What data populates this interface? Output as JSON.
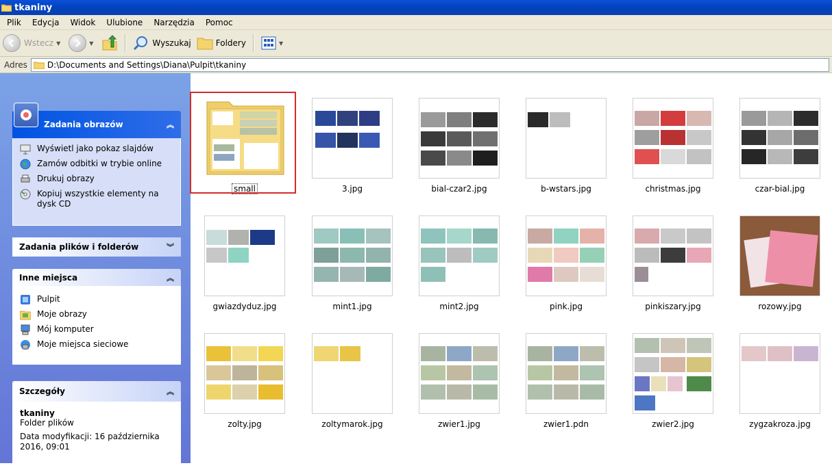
{
  "window": {
    "title": "tkaniny"
  },
  "menu": [
    "Plik",
    "Edycja",
    "Widok",
    "Ulubione",
    "Narzędzia",
    "Pomoc"
  ],
  "toolbar": {
    "back": "Wstecz",
    "search": "Wyszukaj",
    "folders": "Foldery"
  },
  "address": {
    "label": "Adres",
    "path": "D:\\Documents and Settings\\Diana\\Pulpit\\tkaniny"
  },
  "sidebar": {
    "image_tasks": {
      "title": "Zadania obrazów",
      "items": [
        "Wyświetl jako pokaz slajdów",
        "Zamów odbitki w trybie online",
        "Drukuj obrazy",
        "Kopiuj wszystkie elementy na dysk CD"
      ]
    },
    "file_tasks": {
      "title": "Zadania plików i folderów"
    },
    "other_places": {
      "title": "Inne miejsca",
      "items": [
        "Pulpit",
        "Moje obrazy",
        "Mój komputer",
        "Moje miejsca sieciowe"
      ]
    },
    "details": {
      "title": "Szczegóły",
      "name": "tkaniny",
      "type": "Folder plików",
      "modified": "Data modyfikacji: 16 października 2016, 09:01"
    }
  },
  "files": [
    "small",
    "3.jpg",
    "bial-czar2.jpg",
    "b-wstars.jpg",
    "christmas.jpg",
    "czar-bial.jpg",
    "gwiazdyduz.jpg",
    "mint1.jpg",
    "mint2.jpg",
    "pink.jpg",
    "pinkiszary.jpg",
    "rozowy.jpg",
    "zolty.jpg",
    "zoltymarok.jpg",
    "zwier1.jpg",
    "zwier1.pdn",
    "zwier2.jpg",
    "zygzakroza.jpg"
  ],
  "colors": {
    "title_bar": "#0a50d8",
    "sidebar": "#6f8fdf",
    "selection": "#d42a2a"
  }
}
